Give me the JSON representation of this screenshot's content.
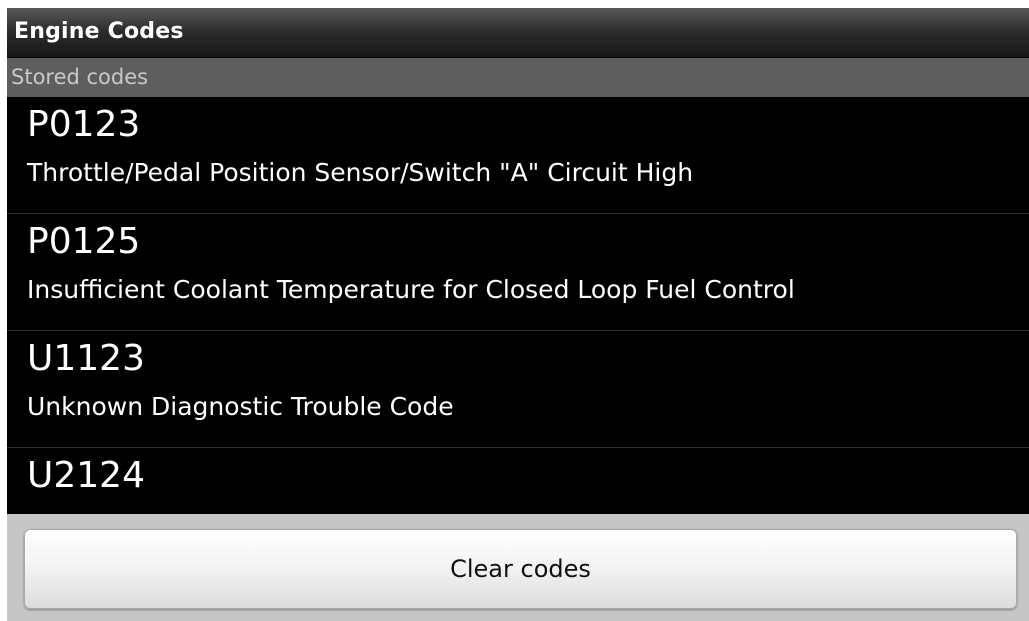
{
  "app": {
    "title": "Engine Codes"
  },
  "section": {
    "header": "Stored codes"
  },
  "codes": [
    {
      "code": "P0123",
      "description": "Throttle/Pedal Position Sensor/Switch \"A\" Circuit High"
    },
    {
      "code": "P0125",
      "description": "Insufficient Coolant Temperature for Closed Loop Fuel Control"
    },
    {
      "code": "U1123",
      "description": "Unknown Diagnostic Trouble Code"
    },
    {
      "code": "U2124",
      "description": ""
    }
  ],
  "actions": {
    "clear_label": "Clear codes"
  },
  "colors": {
    "background": "#000000",
    "section_header_bg": "#5e5e5e",
    "button_bar_bg": "#c6c6c6",
    "text_primary": "#ffffff"
  }
}
